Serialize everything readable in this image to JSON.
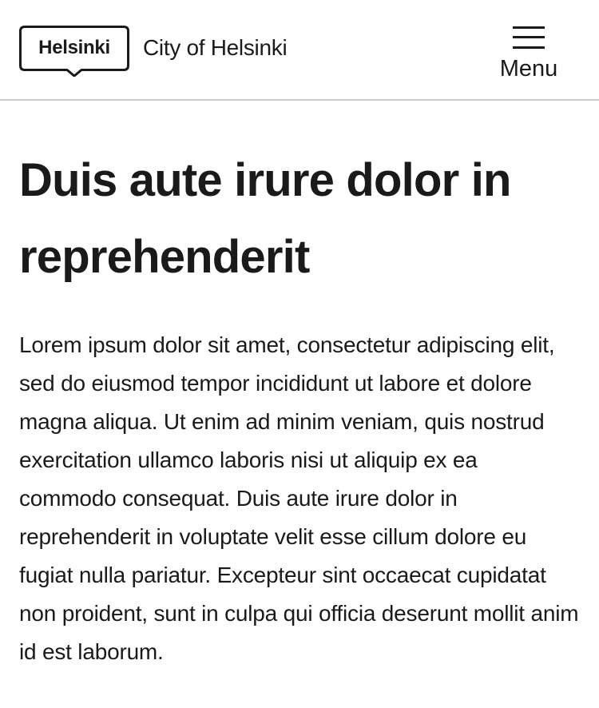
{
  "header": {
    "logo_text": "Helsinki",
    "site_name": "City of Helsinki",
    "menu_label": "Menu"
  },
  "main": {
    "title": "Duis aute irure dolor in reprehenderit",
    "lead": "Lorem ipsum dolor sit amet, consectetur adipiscing elit, sed do eiusmod tempor incididunt ut labore et dolore magna aliqua. Ut enim ad minim veniam, quis nostrud exercitation ullamco laboris nisi ut aliquip ex ea commodo consequat. Duis aute irure dolor in reprehenderit in voluptate velit esse cillum dolore eu fugiat nulla pariatur. Excepteur sint occaecat cupidatat non proident, sunt in culpa qui officia deserunt mollit anim id est laborum."
  },
  "colors": {
    "text": "#1a1a1a",
    "background": "#ffffff",
    "divider": "#cccccc"
  },
  "icons": {
    "logo": "helsinki-logo",
    "menu": "hamburger-icon"
  }
}
